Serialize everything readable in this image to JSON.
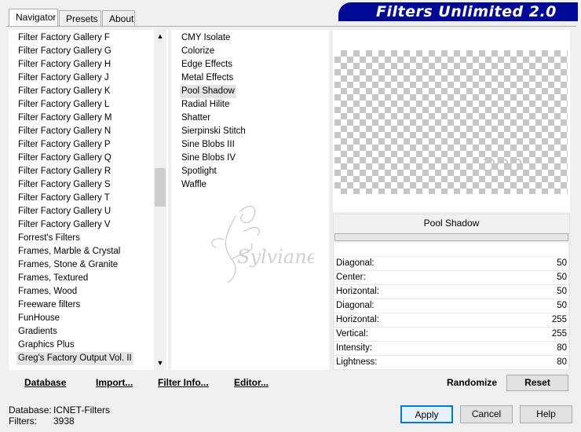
{
  "tabs": [
    "Navigator",
    "Presets",
    "About"
  ],
  "app_title": "Filters Unlimited 2.0",
  "categories": [
    "Filter Factory Gallery F",
    "Filter Factory Gallery G",
    "Filter Factory Gallery H",
    "Filter Factory Gallery J",
    "Filter Factory Gallery K",
    "Filter Factory Gallery L",
    "Filter Factory Gallery M",
    "Filter Factory Gallery N",
    "Filter Factory Gallery P",
    "Filter Factory Gallery Q",
    "Filter Factory Gallery R",
    "Filter Factory Gallery S",
    "Filter Factory Gallery T",
    "Filter Factory Gallery U",
    "Filter Factory Gallery V",
    "Forrest's Filters",
    "Frames, Marble & Crystal",
    "Frames, Stone & Granite",
    "Frames, Textured",
    "Frames, Wood",
    "Freeware filters",
    "FunHouse",
    "Gradients",
    "Graphics Plus",
    "Greg's Factory Output Vol. II"
  ],
  "selected_category": "Greg's Factory Output Vol. II",
  "filters": [
    "CMY Isolate",
    "Colorize",
    "Edge Effects",
    "Metal Effects",
    "Pool Shadow",
    "Radial Hilite",
    "Shatter",
    "Sierpinski Stitch",
    "Sine Blobs III",
    "Sine Blobs IV",
    "Spotlight",
    "Waffle"
  ],
  "selected_filter": "Pool Shadow",
  "filter_name": "Pool Shadow",
  "params": [
    {
      "label": "Diagonal:",
      "value": "50",
      "level": 0.196
    },
    {
      "label": "Center:",
      "value": "50",
      "level": 0.196
    },
    {
      "label": "Horizontal:",
      "value": "50",
      "level": 0.196
    },
    {
      "label": "Diagonal:",
      "value": "50",
      "level": 0.196
    },
    {
      "label": "Horizontal:",
      "value": "255",
      "level": 1.0
    },
    {
      "label": "Vertical:",
      "value": "255",
      "level": 1.0
    },
    {
      "label": "Intensity:",
      "value": "80",
      "level": 0.314
    },
    {
      "label": "Lightness:",
      "value": "80",
      "level": 0.314
    }
  ],
  "buttons": {
    "database": "Database",
    "import": "Import...",
    "filter_info": "Filter Info...",
    "editor": "Editor...",
    "randomize": "Randomize",
    "reset": "Reset",
    "apply": "Apply",
    "cancel": "Cancel",
    "help": "Help"
  },
  "status": {
    "database_label": "Database:",
    "database_value": "ICNET-Filters",
    "filters_label": "Filters:",
    "filters_value": "3938"
  }
}
